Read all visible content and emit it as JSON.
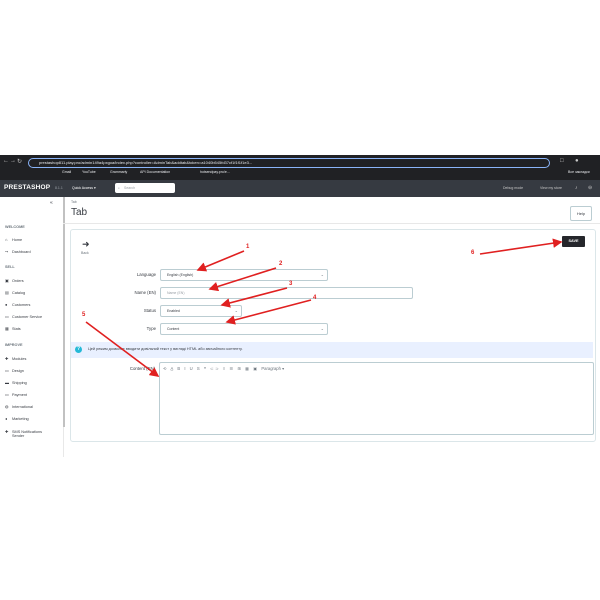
{
  "browser": {
    "url": "prestashop811.play.pro/admin149a4pxgoa/index.php?controller=AdminTab&addtab&token=a1040b545fd37cf1f1f1f1e3...",
    "bookmarks": [
      "Gmail",
      "YouTube",
      "Grammarly",
      "API Documentation",
      "hotsendpay.pro/e..."
    ],
    "all_bookmarks": "Все закладки"
  },
  "header": {
    "logo": "PRESTASHOP",
    "version": "8.1.1",
    "quick_access": "Quick Access ▾",
    "search_placeholder": "Search",
    "debug_mode": "Debug mode",
    "view_store": "View my store"
  },
  "sidebar": {
    "welcome": "WELCOME",
    "home": "Home",
    "dashboard": "Dashboard",
    "sell": "SELL",
    "orders": "Orders",
    "catalog": "Catalog",
    "customers": "Customers",
    "customer_service": "Customer Service",
    "stats": "Stats",
    "improve": "IMPROVE",
    "modules": "Modules",
    "design": "Design",
    "shipping": "Shipping",
    "payment": "Payment",
    "international": "International",
    "marketing": "Marketing",
    "sms_1": "SMS Notifications",
    "sms_2": "Sender"
  },
  "page": {
    "breadcrumb": "Tab",
    "title": "Tab",
    "help": "Help",
    "back": "Back",
    "save": "SAVE"
  },
  "form": {
    "language_label": "Language",
    "language_value": "English (English)",
    "name_label": "Name (EN)",
    "name_placeholder": "Name (EN)",
    "status_label": "Status",
    "status_value": "Enabled",
    "type_label": "Type",
    "type_value": "Content",
    "info_text": "Цей режим дозволяє вводити довільний текст у вигляді HTML або звичайного контенту.",
    "content_label": "Content (EN)",
    "paragraph": "Paragraph ▾"
  },
  "annotations": [
    "1",
    "2",
    "3",
    "4",
    "5",
    "6"
  ],
  "colors": {
    "annotation": "#e02020",
    "admin_bar": "#363a41",
    "save_button": "#25262b",
    "info_bg": "#e9f0ff"
  }
}
